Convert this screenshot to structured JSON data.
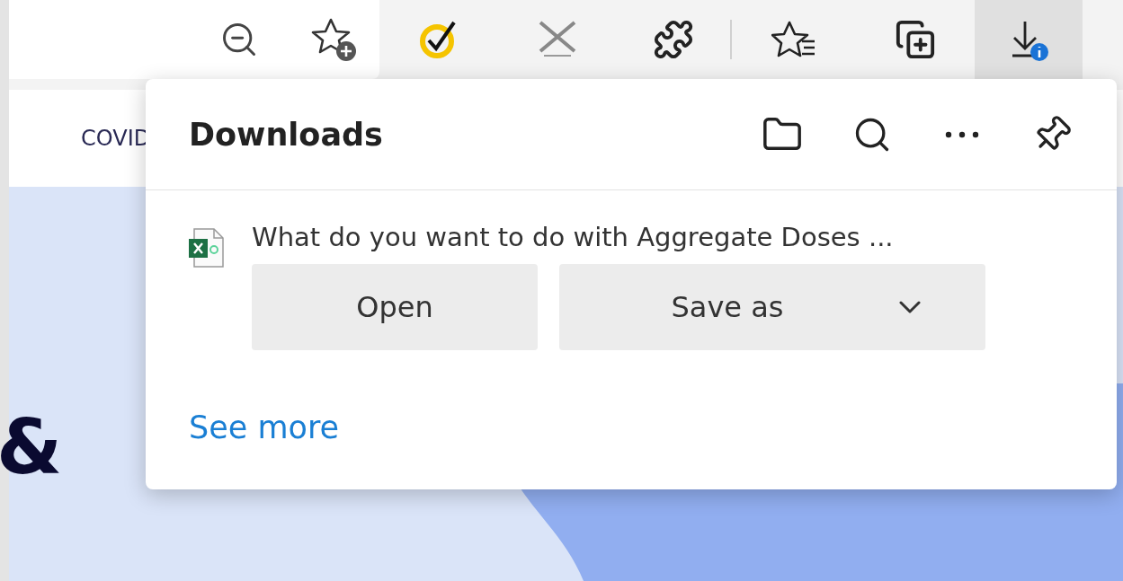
{
  "toolbar": {
    "download_button": {
      "active": true,
      "badge": true
    }
  },
  "page": {
    "nav_text": "COVID",
    "hero_text": "&"
  },
  "downloads_panel": {
    "title": "Downloads",
    "item": {
      "prompt": "What do you want to do with Aggregate Doses ...",
      "buttons": [
        {
          "label": "Open",
          "kind": "plain"
        },
        {
          "label": "Save as",
          "kind": "dropdown"
        }
      ]
    },
    "link": "See more"
  }
}
